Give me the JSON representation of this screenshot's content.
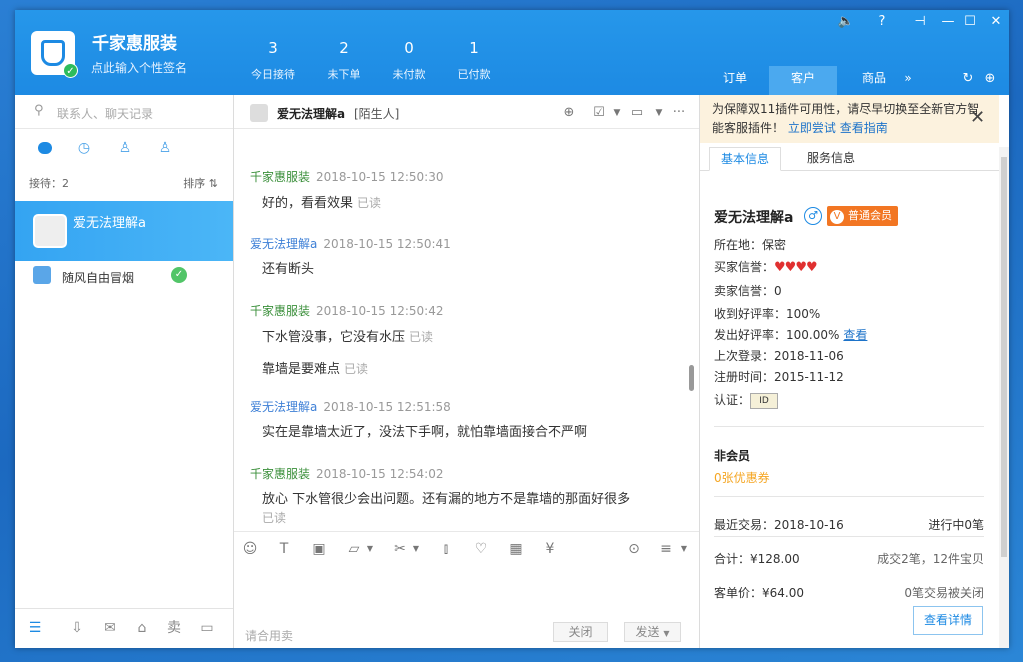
{
  "header": {
    "shop_name": "千家惠服装",
    "signature": "点此输入个性签名",
    "stats": [
      {
        "value": "3",
        "label": "今日接待"
      },
      {
        "value": "2",
        "label": "未下单"
      },
      {
        "value": "0",
        "label": "未付款"
      },
      {
        "value": "1",
        "label": "已付款"
      }
    ],
    "tabs": [
      "订单",
      "客户",
      "商品"
    ],
    "active_tab": "客户"
  },
  "sidebar": {
    "search_placeholder": "联系人、聊天记录",
    "receiving": "接待：2",
    "sort": "排序 ⇅",
    "contacts": [
      {
        "name": "爱无法理解a",
        "selected": true
      },
      {
        "name": "随风自由冒烟",
        "selected": false,
        "status": "green-check"
      }
    ]
  },
  "chat": {
    "contact_name": "爱无法理解a",
    "contact_tag": "[陌生人]",
    "read_label": "已读",
    "messages": [
      {
        "from": "千家惠服装",
        "time": "2018-10-15 12:50:30",
        "role": "seller",
        "texts": [
          "好的，看看效果"
        ]
      },
      {
        "from": "爱无法理解a",
        "time": "2018-10-15 12:50:41",
        "role": "buyer",
        "texts": [
          "还有断头"
        ]
      },
      {
        "from": "千家惠服装",
        "time": "2018-10-15 12:50:42",
        "role": "seller",
        "texts": [
          "下水管没事，它没有水压",
          "靠墙是要难点"
        ]
      },
      {
        "from": "爱无法理解a",
        "time": "2018-10-15 12:51:58",
        "role": "buyer",
        "texts": [
          "实在是靠墙太近了，没法下手啊，就怕靠墙面接合不严啊"
        ]
      },
      {
        "from": "千家惠服装",
        "time": "2018-10-15 12:54:02",
        "role": "seller",
        "texts": [
          "放心 下水管很少会出问题。还有漏的地方不是靠墙的那面好很多"
        ]
      }
    ],
    "input_placeholder": "请合用卖",
    "close_label": "关闭",
    "send_label": "发送"
  },
  "customer_panel": {
    "notice_text": "为保障双11插件可用性，请尽早切换至全新官方智能客服插件！",
    "notice_link_try": "立即尝试",
    "notice_link_guide": "查看指南",
    "tabs": [
      "基本信息",
      "服务信息"
    ],
    "name": "爱无法理解a",
    "member_level": "普通会员",
    "location": "所在地：保密",
    "buyer_credit_label": "买家信誉：",
    "seller_credit": "卖家信誉：0",
    "received_rate": "收到好评率：100%",
    "sent_rate": "发出好评率：100.00%",
    "view_link": "查看",
    "last_login": "上次登录：2018-11-06",
    "register_time": "注册时间：2015-11-12",
    "cert_label": "认证：",
    "non_member": "非会员",
    "coupons": "0张优惠券",
    "recent_trade_label": "最近交易：",
    "recent_trade_date": "2018-10-16",
    "in_progress": "进行中0笔",
    "total_label": "合计：",
    "total_amount": "¥128.00",
    "deals": "成交2笔，12件宝贝",
    "avg_label": "客单价：",
    "avg_amount": "¥64.00",
    "closed_deals": "0笔交易被关闭",
    "details_button": "查看详情"
  },
  "colors": {
    "titlebar": "#1d8ae3",
    "seller_name": "#3a8f3a",
    "buyer_name": "#3d7fd6",
    "member_badge": "#f27623"
  }
}
